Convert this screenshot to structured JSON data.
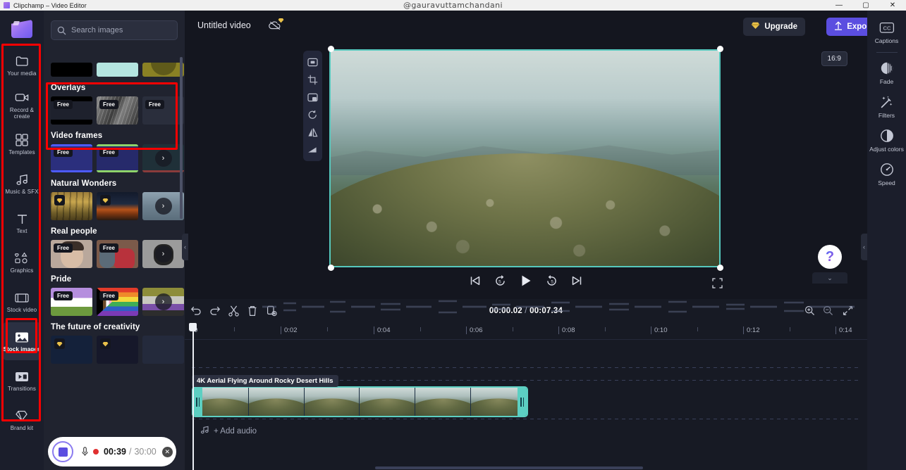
{
  "titlebar": {
    "app_title": "Clipchamp – Video Editor",
    "watermark": "@gauravuttamchandani",
    "minimize": "—",
    "maximize": "▢",
    "close": "✕"
  },
  "sidebar": {
    "items": [
      {
        "label": "Your media",
        "icon": "folder-icon"
      },
      {
        "label": "Record & create",
        "icon": "video-camera-icon"
      },
      {
        "label": "Templates",
        "icon": "grid-icon"
      },
      {
        "label": "Music & SFX",
        "icon": "music-note-icon"
      },
      {
        "label": "Text",
        "icon": "text-icon"
      },
      {
        "label": "Graphics",
        "icon": "shapes-icon"
      },
      {
        "label": "Stock video",
        "icon": "film-icon"
      },
      {
        "label": "Stock images",
        "icon": "image-icon"
      },
      {
        "label": "Transitions",
        "icon": "transitions-icon"
      },
      {
        "label": "Brand kit",
        "icon": "brand-kit-icon"
      }
    ],
    "active": "Stock images"
  },
  "panel": {
    "search_placeholder": "Search images",
    "free_tag": "Free",
    "arrow": "›",
    "sections": [
      {
        "title": "Overlays"
      },
      {
        "title": "Video frames"
      },
      {
        "title": "Natural Wonders"
      },
      {
        "title": "Real people"
      },
      {
        "title": "Pride"
      },
      {
        "title": "The future of creativity"
      }
    ]
  },
  "recording": {
    "elapsed": "00:39",
    "separator": "/",
    "total": "30:00",
    "stop": "stop-recording",
    "close": "✕"
  },
  "topbar": {
    "project_title": "Untitled video",
    "cloud_status_icon": "cloud-off-icon",
    "upgrade_label": "Upgrade",
    "export_label": "Export",
    "export_chevron": "⌄"
  },
  "right_rail": {
    "items": [
      {
        "label": "Captions",
        "icon": "closed-captions-icon"
      },
      {
        "label": "Fade",
        "icon": "fade-icon"
      },
      {
        "label": "Filters",
        "icon": "magic-wand-icon"
      },
      {
        "label": "Adjust colors",
        "icon": "contrast-icon"
      },
      {
        "label": "Speed",
        "icon": "speedometer-icon"
      }
    ]
  },
  "preview": {
    "aspect_ratio": "16:9",
    "tools": [
      {
        "name": "fit-to-screen-icon"
      },
      {
        "name": "crop-icon"
      },
      {
        "name": "picture-in-picture-icon"
      },
      {
        "name": "rotate-icon"
      },
      {
        "name": "flip-horizontal-icon"
      },
      {
        "name": "skew-icon"
      }
    ],
    "playback": [
      {
        "name": "skip-to-start-icon"
      },
      {
        "name": "rewind-5-icon"
      },
      {
        "name": "play-icon"
      },
      {
        "name": "forward-5-icon"
      },
      {
        "name": "skip-to-end-icon"
      }
    ],
    "fullscreen_icon": "fullscreen-icon",
    "help_label": "?",
    "collapse_chevron": "⌄"
  },
  "timeline": {
    "toolbar": [
      {
        "name": "undo-icon"
      },
      {
        "name": "redo-icon"
      },
      {
        "name": "split-icon"
      },
      {
        "name": "delete-icon"
      },
      {
        "name": "duplicate-icon"
      }
    ],
    "current_time": "00:00.02",
    "separator": " / ",
    "duration": "00:07.34",
    "zoom_in_icon": "zoom-in-icon",
    "zoom_out_icon": "zoom-out-icon",
    "fit_icon": "fit-timeline-icon",
    "ruler_labels": [
      "0",
      "0:02",
      "0:04",
      "0:06",
      "0:08",
      "0:10",
      "0:12",
      "0:14"
    ],
    "clip": {
      "title": "4K Aerial Flying Around Rocky Desert Hills"
    },
    "add_audio_label": "+ Add audio"
  },
  "colors": {
    "accent_purple": "#5b4ee0",
    "selection_teal": "#5ccfc2",
    "annotation_red": "#fb0000",
    "panel_bg": "#20232f",
    "rail_bg": "#1b1e2b",
    "stage_bg": "#14161f",
    "record_red": "#e03030"
  }
}
